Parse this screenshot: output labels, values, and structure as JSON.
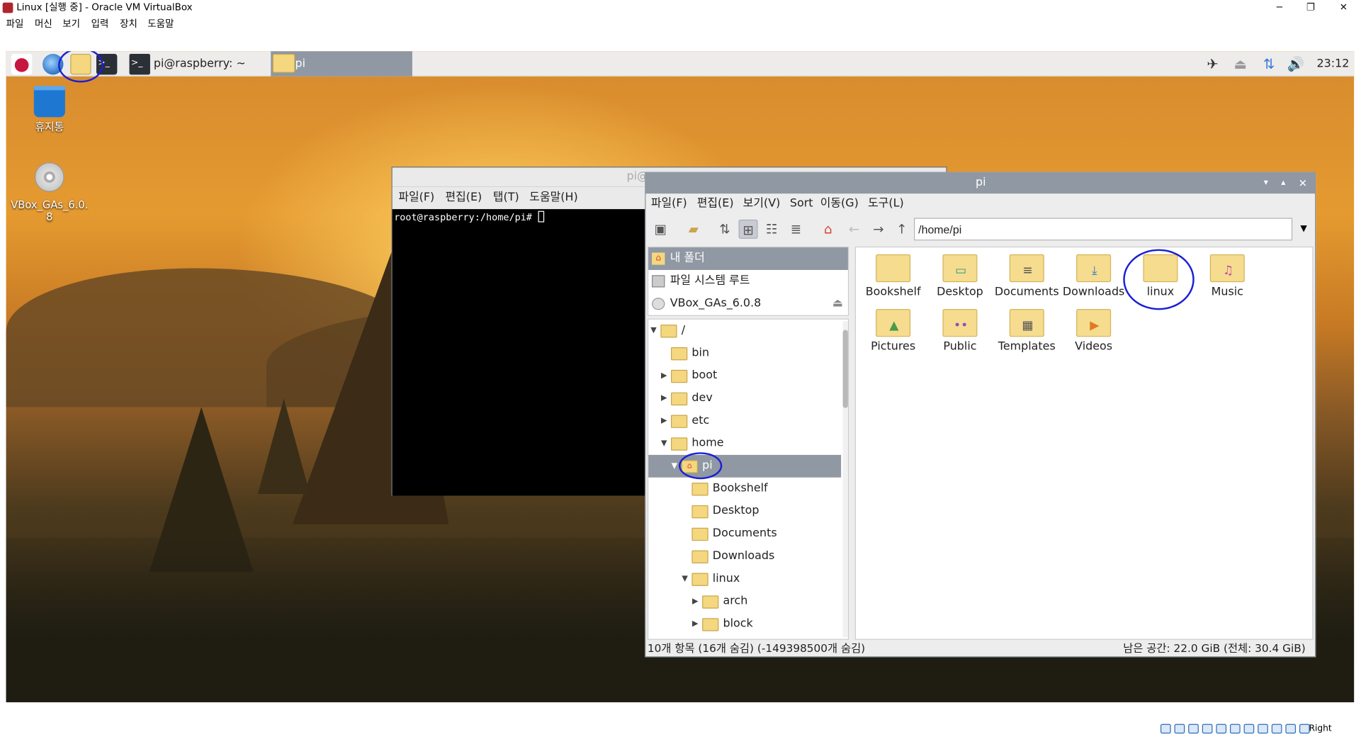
{
  "host": {
    "title": "Linux [실행 중] - Oracle VM VirtualBox",
    "menu": [
      "파일",
      "머신",
      "보기",
      "입력",
      "장치",
      "도움말"
    ],
    "window_buttons": {
      "minimize": "─",
      "maximize": "❐",
      "close": "✕"
    },
    "status_right": "Right Control"
  },
  "panel": {
    "tasks": [
      {
        "label": "pi@raspberry: ~",
        "icon": "terminal-icon"
      },
      {
        "label": "pi",
        "icon": "folder-icon"
      }
    ],
    "clock": "23:12",
    "tray": [
      "bluetooth-icon",
      "eject-icon",
      "network-icon",
      "volume-icon"
    ]
  },
  "desktop": {
    "icons": [
      {
        "label": "휴지통",
        "icon": "trash-icon"
      },
      {
        "label": "VBox_GAs_6.0.8",
        "icon": "cdrom-icon"
      }
    ]
  },
  "terminal": {
    "title": "pi@",
    "menu": [
      "파일(F)",
      "편집(E)",
      "탭(T)",
      "도움말(H)"
    ],
    "prompt": "root@raspberry:/home/pi# "
  },
  "filemanager": {
    "title": "pi",
    "menu": [
      "파일(F)",
      "편집(E)",
      "보기(V)",
      "Sort",
      "이동(G)",
      "도구(L)"
    ],
    "path": "/home/pi",
    "places": [
      "내 폴더",
      "파일 시스템 루트",
      "VBox_GAs_6.0.8"
    ],
    "tree": [
      {
        "label": "/",
        "arrow": "▼"
      },
      {
        "label": "bin",
        "arrow": ""
      },
      {
        "label": "boot",
        "arrow": "▶"
      },
      {
        "label": "dev",
        "arrow": "▶"
      },
      {
        "label": "etc",
        "arrow": "▶"
      },
      {
        "label": "home",
        "arrow": "▼"
      },
      {
        "label": "pi",
        "arrow": "▼"
      },
      {
        "label": "Bookshelf",
        "arrow": ""
      },
      {
        "label": "Desktop",
        "arrow": ""
      },
      {
        "label": "Documents",
        "arrow": ""
      },
      {
        "label": "Downloads",
        "arrow": ""
      },
      {
        "label": "linux",
        "arrow": "▼"
      },
      {
        "label": "arch",
        "arrow": "▶"
      },
      {
        "label": "block",
        "arrow": "▶"
      }
    ],
    "items": [
      {
        "label": "Bookshelf",
        "glyph": ""
      },
      {
        "label": "Desktop",
        "glyph": "▭"
      },
      {
        "label": "Documents",
        "glyph": "≡"
      },
      {
        "label": "Downloads",
        "glyph": "⤓"
      },
      {
        "label": "linux",
        "glyph": ""
      },
      {
        "label": "Music",
        "glyph": "♫"
      },
      {
        "label": "Pictures",
        "glyph": "▲"
      },
      {
        "label": "Public",
        "glyph": "••"
      },
      {
        "label": "Templates",
        "glyph": "▦"
      },
      {
        "label": "Videos",
        "glyph": "▶"
      }
    ],
    "status_left": "10개 항목 (16개 숨김) (-149398500개 숨김)",
    "status_right": "남은 공간: 22.0 GiB (전체: 30.4 GiB)"
  },
  "colors": {
    "titlebar": "#8f98a3",
    "annotation": "#1a1fd6",
    "folder": "#f4d77e"
  }
}
